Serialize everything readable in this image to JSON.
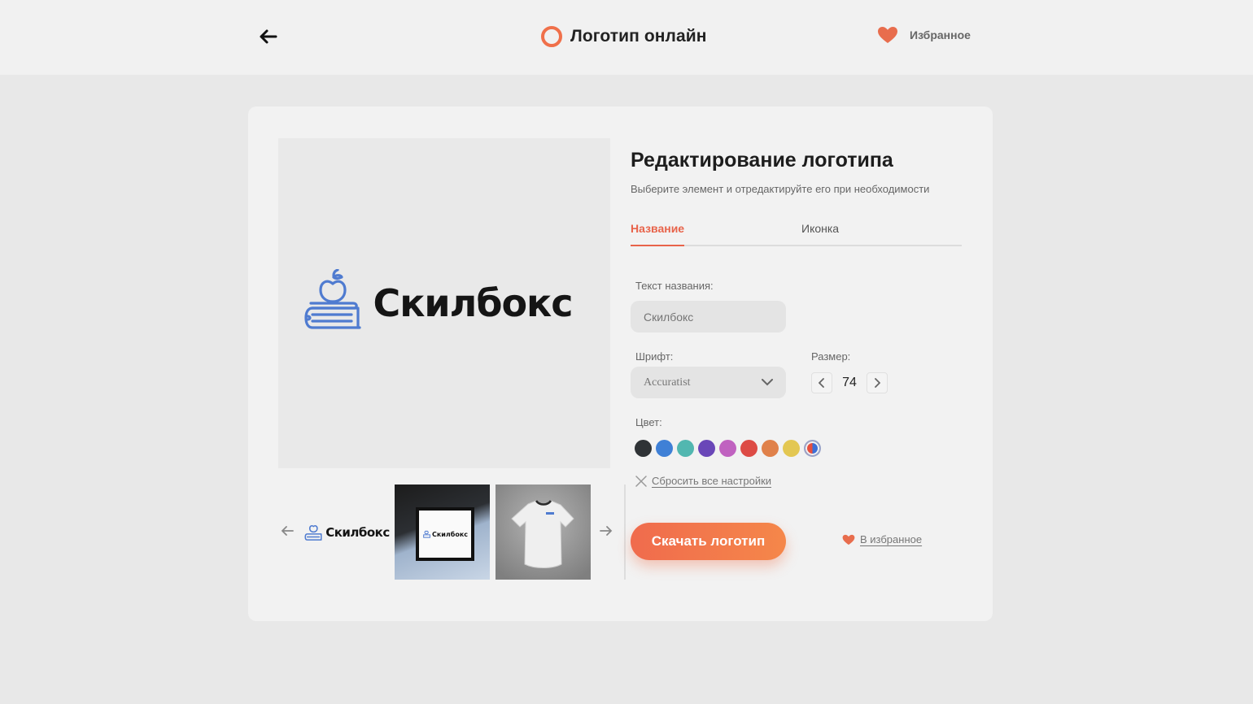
{
  "header": {
    "title": "Логотип онлайн",
    "favorites_label": "Избранное",
    "accent": "#f0704a"
  },
  "preview": {
    "logo_text": "Скилбокс",
    "logo_icon": "apple-books-icon",
    "icon_color": "#4f7bd0"
  },
  "thumbnails": [
    {
      "name": "thumb-logo",
      "text": "Скилбокс"
    },
    {
      "name": "thumb-signboard",
      "text": "Скилбокс"
    },
    {
      "name": "thumb-tshirt"
    }
  ],
  "editor": {
    "title": "Редактирование логотипа",
    "subtitle": "Выберите элемент и отредактируйте его при необходимости",
    "tabs": [
      {
        "label": "Название",
        "active": true
      },
      {
        "label": "Иконка",
        "active": false
      }
    ],
    "name_label": "Текст названия:",
    "name_value": "Скилбокс",
    "font_label": "Шрифт:",
    "font_value": "Accuratist",
    "size_label": "Размер:",
    "size_value": "74",
    "color_label": "Цвет:",
    "colors": [
      "#2f3336",
      "#3f80d6",
      "#52b7b0",
      "#6a47b8",
      "#c062c0",
      "#dd4b45",
      "#e0814a",
      "#e3c752"
    ],
    "reset_label": "Сбросить все настройки",
    "download_label": "Скачать логотип",
    "add_favorite_label": "В избранное"
  }
}
